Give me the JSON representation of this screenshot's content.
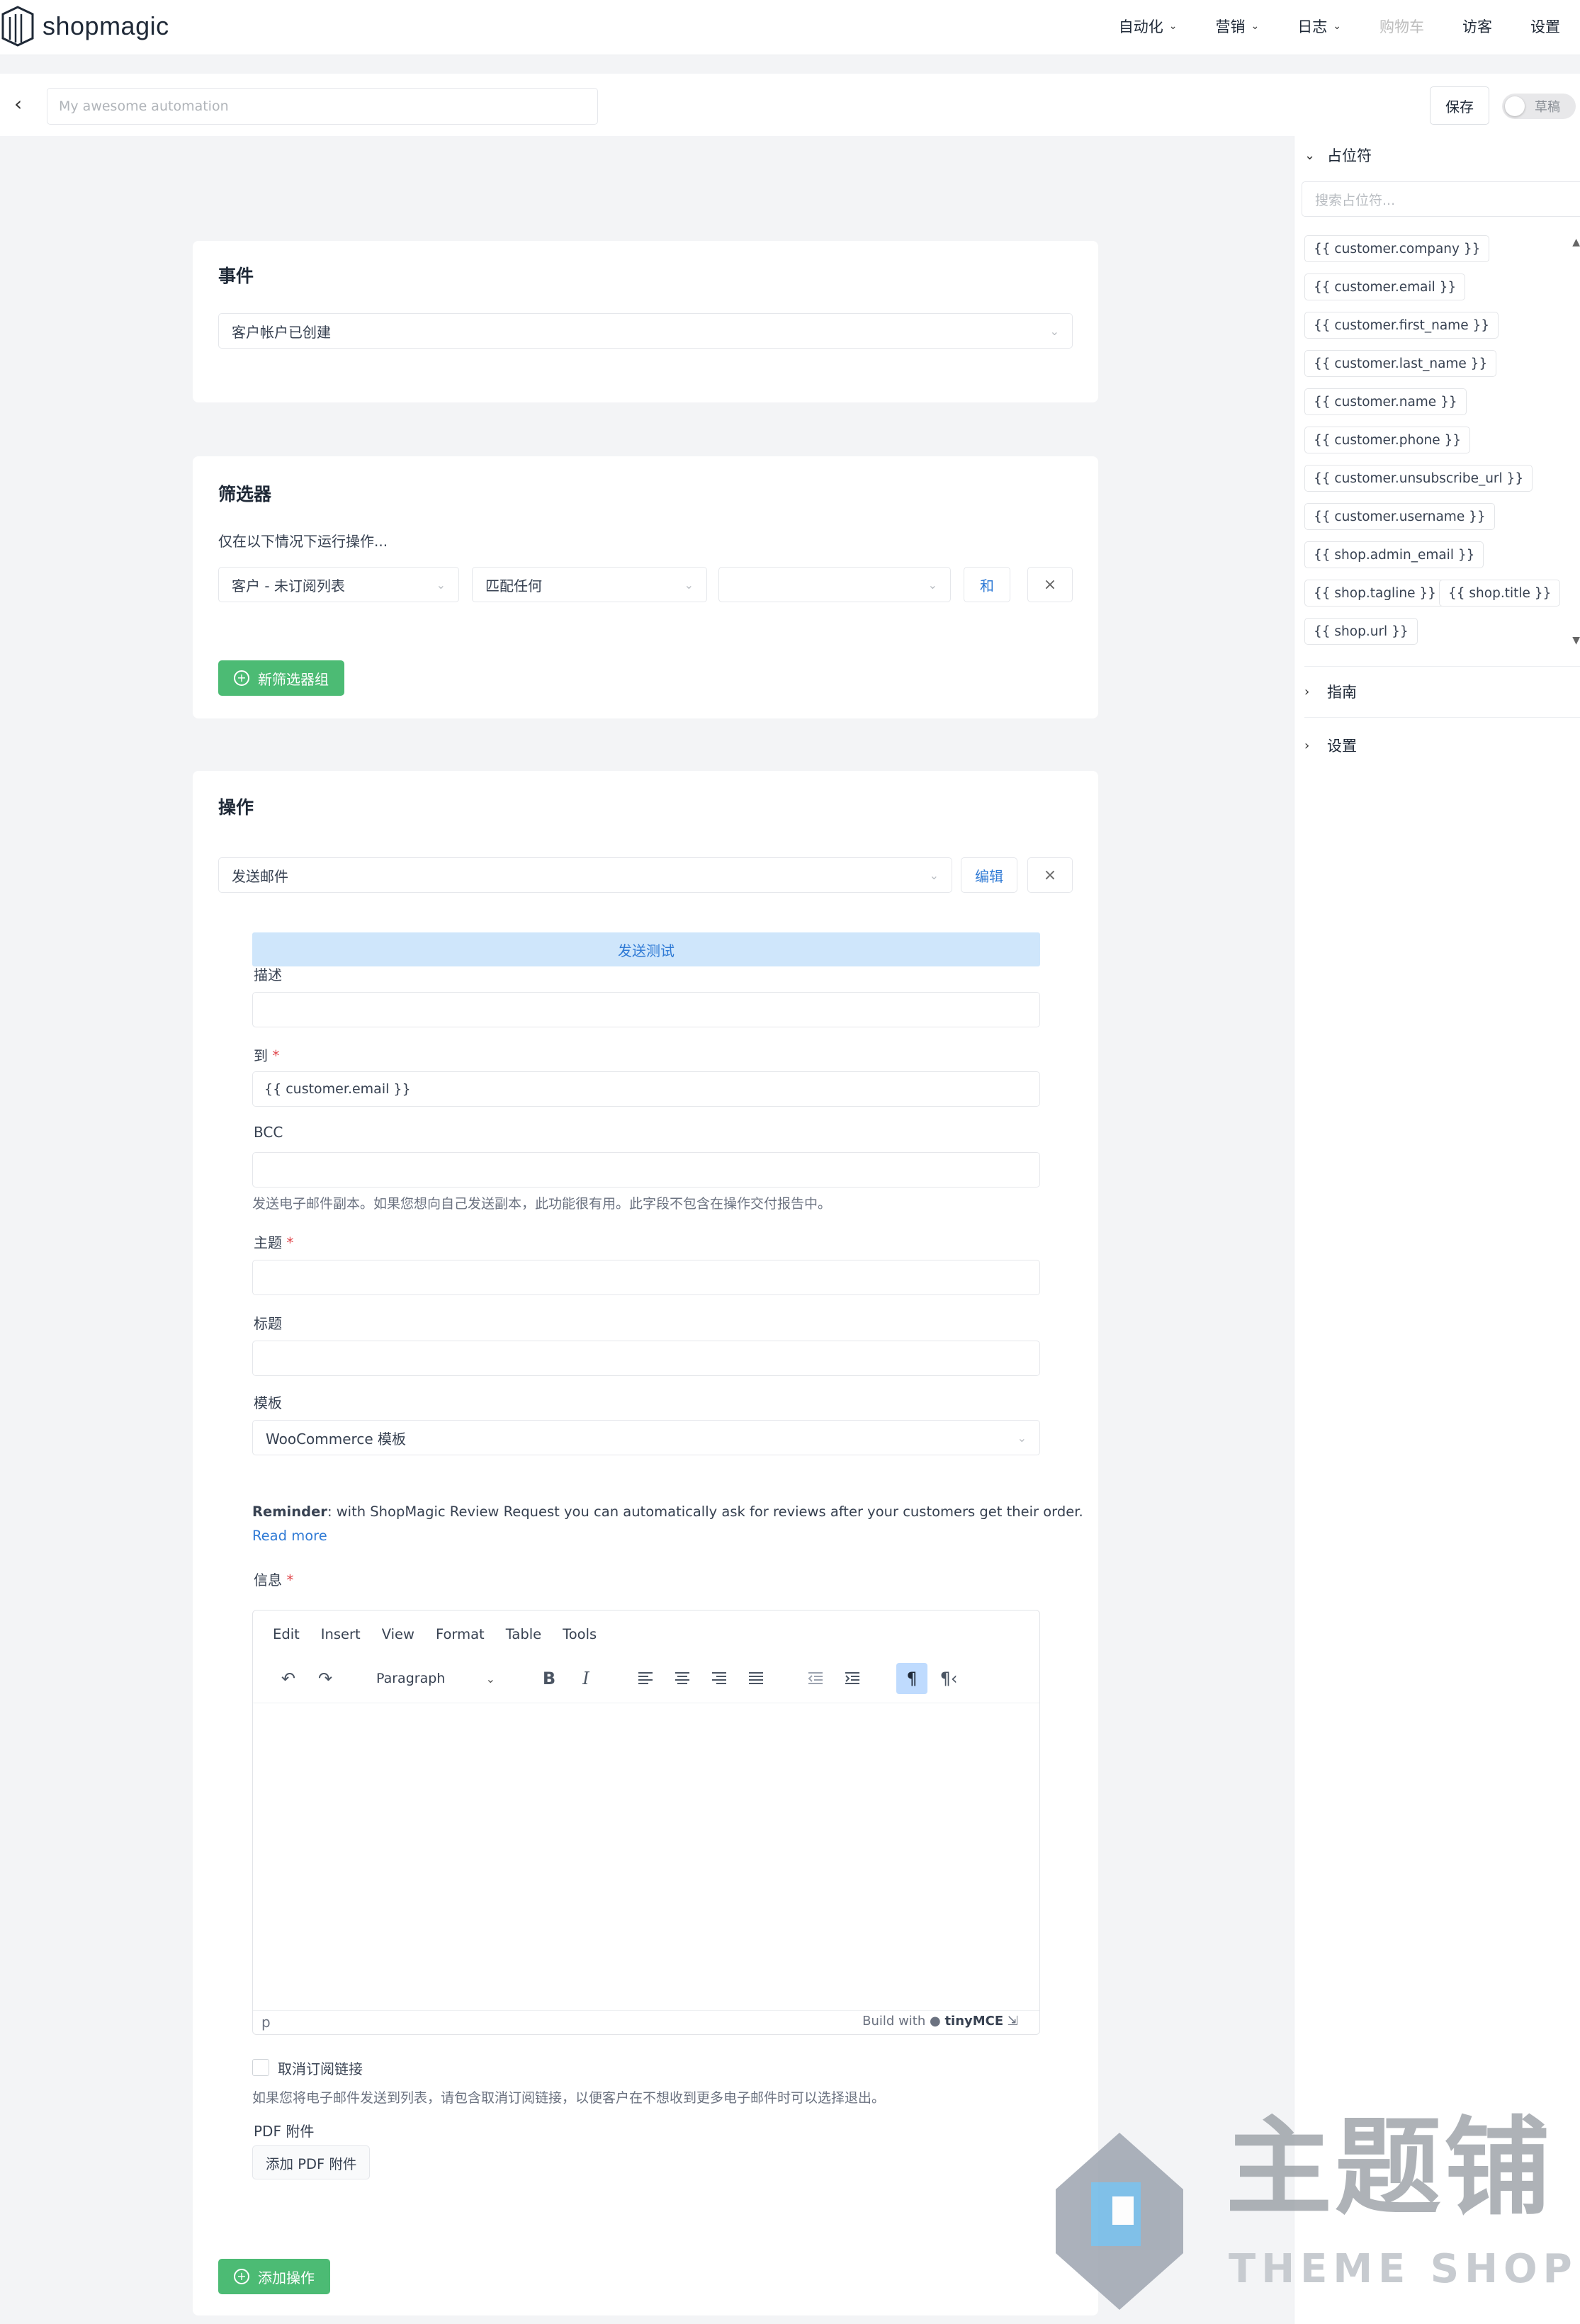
{
  "app": {
    "logo_text": "shopmagic"
  },
  "nav": {
    "items": [
      {
        "label": "自动化",
        "dropdown": true
      },
      {
        "label": "营销",
        "dropdown": true
      },
      {
        "label": "日志",
        "dropdown": true
      },
      {
        "label": "购物车",
        "dropdown": false,
        "disabled": true
      },
      {
        "label": "访客",
        "dropdown": false
      },
      {
        "label": "设置",
        "dropdown": false
      }
    ]
  },
  "subbar": {
    "back_icon": "chevron-left-icon",
    "name_placeholder": "My awesome automation",
    "save_label": "保存",
    "toggle_label": "草稿"
  },
  "sidebar": {
    "placeholders_title": "占位符",
    "search_placeholder": "搜索占位符...",
    "placeholders": [
      "{{ customer.company }}",
      "{{ customer.email }}",
      "{{ customer.first_name }}",
      "{{ customer.last_name }}",
      "{{ customer.name }}",
      "{{ customer.phone }}",
      "{{ customer.unsubscribe_url }}",
      "{{ customer.username }}",
      "{{ shop.admin_email }}",
      "{{ shop.tagline }}",
      "{{ shop.title }}",
      "{{ shop.url }}"
    ],
    "guide_title": "指南",
    "settings_title": "设置"
  },
  "event": {
    "title": "事件",
    "selected": "客户帐户已创建"
  },
  "filters": {
    "title": "筛选器",
    "description": "仅在以下情况下运行操作...",
    "field": "客户 - 未订阅列表",
    "condition": "匹配任何",
    "value": "",
    "and_label": "和",
    "remove_label": "×",
    "add_group_label": "新筛选器组"
  },
  "actions": {
    "title": "操作",
    "selected": "发送邮件",
    "edit_label": "编辑",
    "remove_label": "×",
    "send_test_label": "发送测试",
    "description_label": "描述",
    "description_value": "",
    "to_label": "到",
    "to_value": "{{ customer.email }}",
    "bcc_label": "BCC",
    "bcc_value": "",
    "bcc_help": "发送电子邮件副本。如果您想向自己发送副本，此功能很有用。此字段不包含在操作交付报告中。",
    "subject_label": "主题",
    "subject_value": "",
    "heading_label": "标题",
    "heading_value": "",
    "template_label": "模板",
    "template_value": "WooCommerce 模板",
    "reminder_bold": "Reminder",
    "reminder_text": ": with ShopMagic Review Request you can automatically ask for reviews after your customers get their order.",
    "read_more": "Read more",
    "message_label": "信息",
    "editor": {
      "menu": [
        "Edit",
        "Insert",
        "View",
        "Format",
        "Table",
        "Tools"
      ],
      "block_format": "Paragraph",
      "path": "p",
      "build_with": "Build with",
      "brand": "tinyMCE"
    },
    "unsubscribe_label": "取消订阅链接",
    "unsubscribe_help": "如果您将电子邮件发送到列表，请包含取消订阅链接，以便客户在不想收到更多电子邮件时可以选择退出。",
    "pdf_label": "PDF 附件",
    "add_pdf_label": "添加 PDF 附件",
    "add_action_label": "添加操作"
  },
  "required_mark": "*",
  "watermark": {
    "text_cn": "主题铺",
    "text_en": "THEME SHOP"
  },
  "colors": {
    "accent": "#2f7ad5",
    "green": "#4cbb74",
    "send_test_bg": "#cfe6fb"
  }
}
